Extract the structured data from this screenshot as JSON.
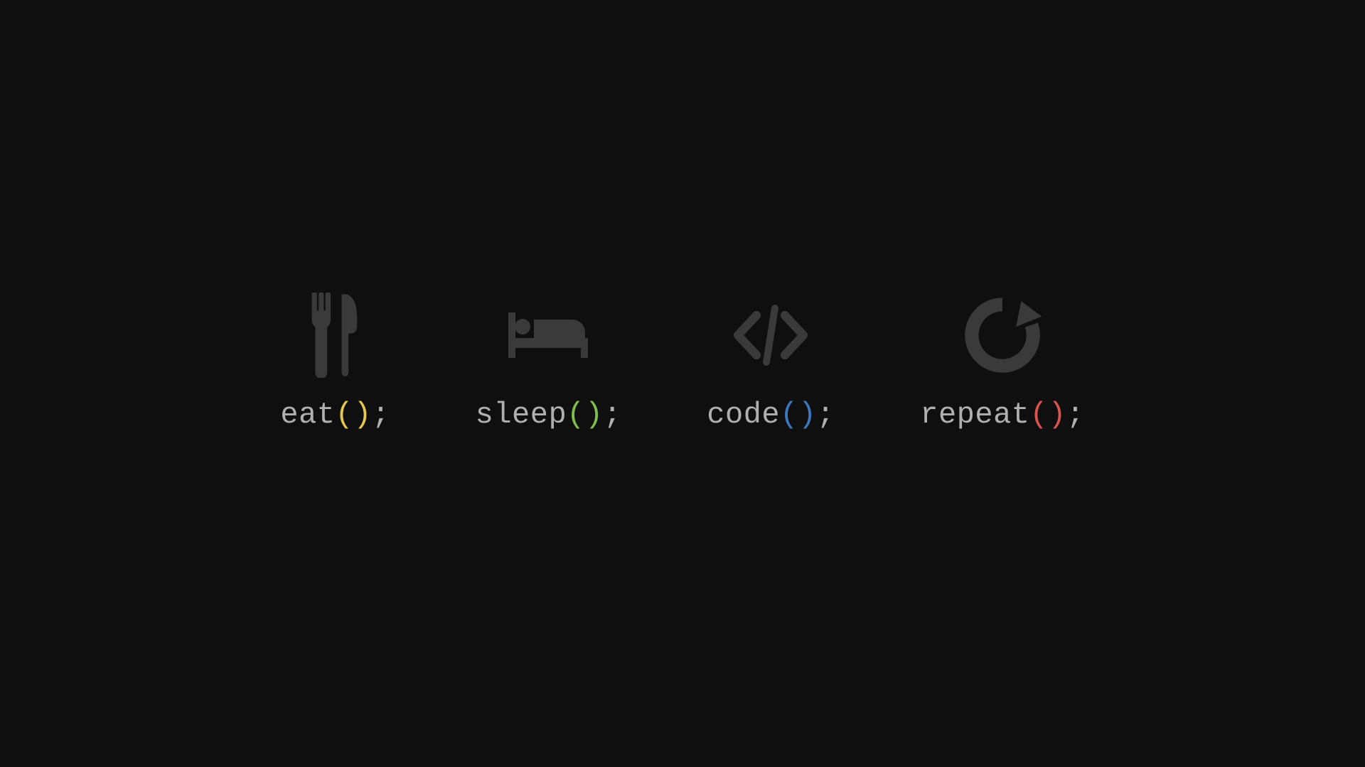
{
  "items": [
    {
      "name": "eat",
      "parens": "()",
      "semi": ";",
      "paren_color": "#e6c84a",
      "icon": "fork-knife-icon"
    },
    {
      "name": "sleep",
      "parens": "()",
      "semi": ";",
      "paren_color": "#7fbf4d",
      "icon": "bed-icon"
    },
    {
      "name": "code",
      "parens": "()",
      "semi": ";",
      "paren_color": "#3a78c2",
      "icon": "code-brackets-icon"
    },
    {
      "name": "repeat",
      "parens": "()",
      "semi": ";",
      "paren_color": "#d9534f",
      "icon": "refresh-icon"
    }
  ],
  "colors": {
    "background": "#0f0f0f",
    "icon": "#3a3a3a",
    "text": "#b0b0b0"
  }
}
